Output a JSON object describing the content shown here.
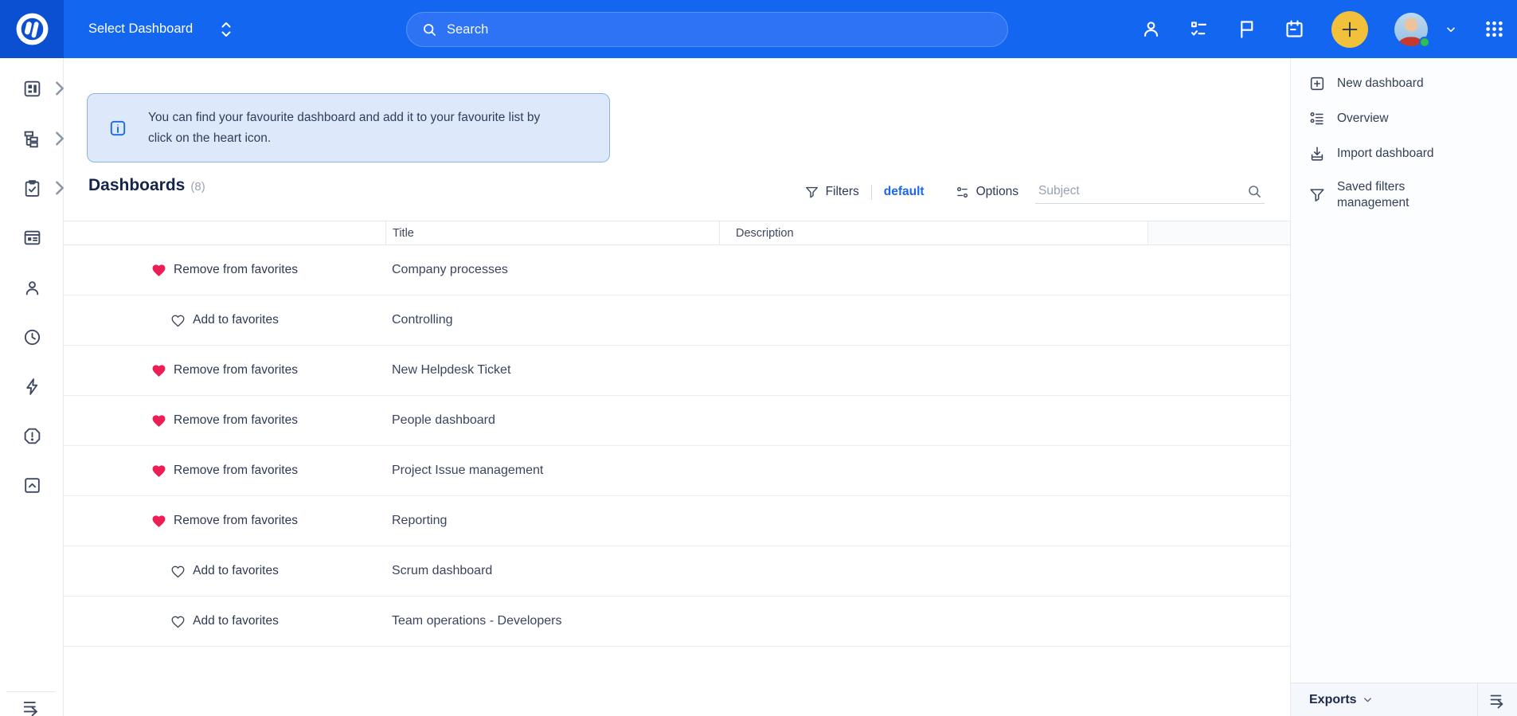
{
  "topbar": {
    "select_dashboard_label": "Select Dashboard",
    "search_placeholder": "Search",
    "icons": [
      "app-logo",
      "sort-chevrons-icon",
      "search-icon",
      "user-icon",
      "tasks-checklist-icon",
      "flag-icon",
      "calendar-icon",
      "add-button",
      "user-avatar",
      "chevron-down-icon",
      "apps-grid-icon"
    ],
    "colors": {
      "bar": "#1266f0",
      "logo_square": "#0b50d0",
      "add_button": "#f1c13b",
      "status_dot": "#2ec04f"
    }
  },
  "sidebar": {
    "icons": [
      "dashboard-icon",
      "hierarchy-icon",
      "clipboard-check-icon",
      "browser-window-icon",
      "person-icon",
      "clock-icon",
      "bolt-icon",
      "alert-octagon-icon",
      "box-collapse-icon",
      "expand-sidebar-icon"
    ]
  },
  "banner": {
    "icon": "info-icon",
    "text": "You can find your favourite dashboard and add it to your favourite list by click on the heart icon.",
    "colors": {
      "bg": "#dde9fa",
      "border": "#8ab4e8",
      "icon": "#1a6be0"
    }
  },
  "header": {
    "title": "Dashboards",
    "count": "(8)"
  },
  "toolbar": {
    "filters_label": "Filters",
    "filter_value": "default",
    "options_label": "Options",
    "subject_placeholder": "Subject",
    "accent": "#1b66f0"
  },
  "table": {
    "columns": {
      "title": "Title",
      "description": "Description"
    },
    "favorite_heart_color": "#ed1e56",
    "rows": [
      {
        "favorited": true,
        "favorite_action": "Remove from favorites",
        "title": "Company processes",
        "description": ""
      },
      {
        "favorited": false,
        "favorite_action": "Add to favorites",
        "title": "Controlling",
        "description": ""
      },
      {
        "favorited": true,
        "favorite_action": "Remove from favorites",
        "title": "New Helpdesk Ticket",
        "description": ""
      },
      {
        "favorited": true,
        "favorite_action": "Remove from favorites",
        "title": "People dashboard",
        "description": ""
      },
      {
        "favorited": true,
        "favorite_action": "Remove from favorites",
        "title": "Project Issue management",
        "description": ""
      },
      {
        "favorited": true,
        "favorite_action": "Remove from favorites",
        "title": "Reporting",
        "description": ""
      },
      {
        "favorited": false,
        "favorite_action": "Add to favorites",
        "title": "Scrum dashboard",
        "description": ""
      },
      {
        "favorited": false,
        "favorite_action": "Add to favorites",
        "title": "Team operations - Developers",
        "description": ""
      }
    ]
  },
  "right_panel": {
    "items": [
      {
        "icon": "plus-square-icon",
        "label": "New dashboard"
      },
      {
        "icon": "list-options-icon",
        "label": "Overview"
      },
      {
        "icon": "import-icon",
        "label": "Import dashboard"
      },
      {
        "icon": "funnel-icon",
        "label": "Saved filters management"
      }
    ],
    "exports_label": "Exports",
    "collapse_icon": "expand-panel-icon"
  }
}
